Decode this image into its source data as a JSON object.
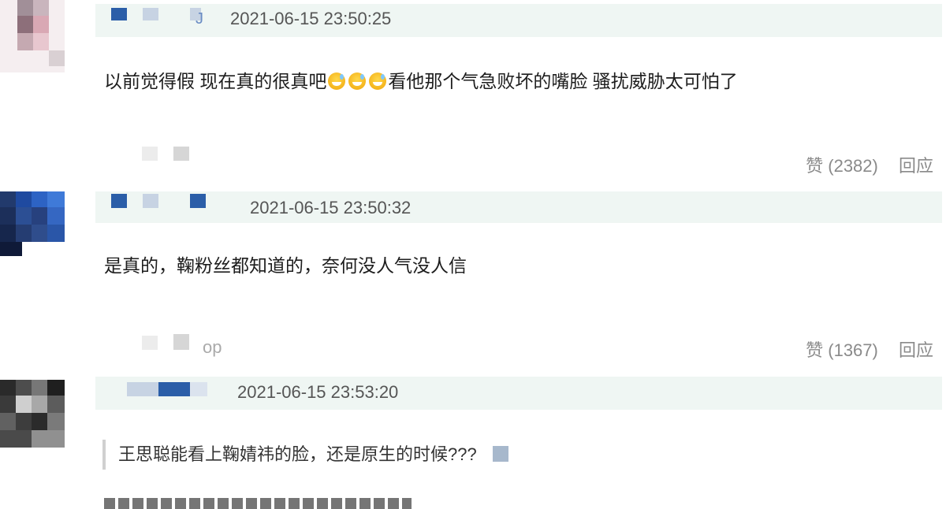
{
  "comments": [
    {
      "timestamp": "2021-06-15 23:50:25",
      "text_before": "以前觉得假 现在真的很真吧",
      "emojis": [
        "grinning-sweat-emoji",
        "grinning-sweat-emoji",
        "grinning-sweat-emoji"
      ],
      "text_after": "看他那个气急败坏的嘴脸 骚扰威胁太可怕了",
      "like_label": "赞 (2382)",
      "reply_label": "回应",
      "username_partial": "J"
    },
    {
      "timestamp": "2021-06-15 23:50:32",
      "text": "是真的，鞠粉丝都知道的，奈何没人气没人信",
      "like_label": "赞 (1367)",
      "reply_label": "回应",
      "reply_user_partial": "op"
    },
    {
      "timestamp": "2021-06-15 23:53:20",
      "quote": "王思聪能看上鞠婧祎的脸，还是原生的时候???"
    }
  ],
  "colors": {
    "header_bg": "#eff6f3",
    "timestamp": "#555555",
    "action_text": "#8a8a8a",
    "mosaic_blue": "#2b5ea8",
    "mosaic_light": "#c7d3e3"
  }
}
